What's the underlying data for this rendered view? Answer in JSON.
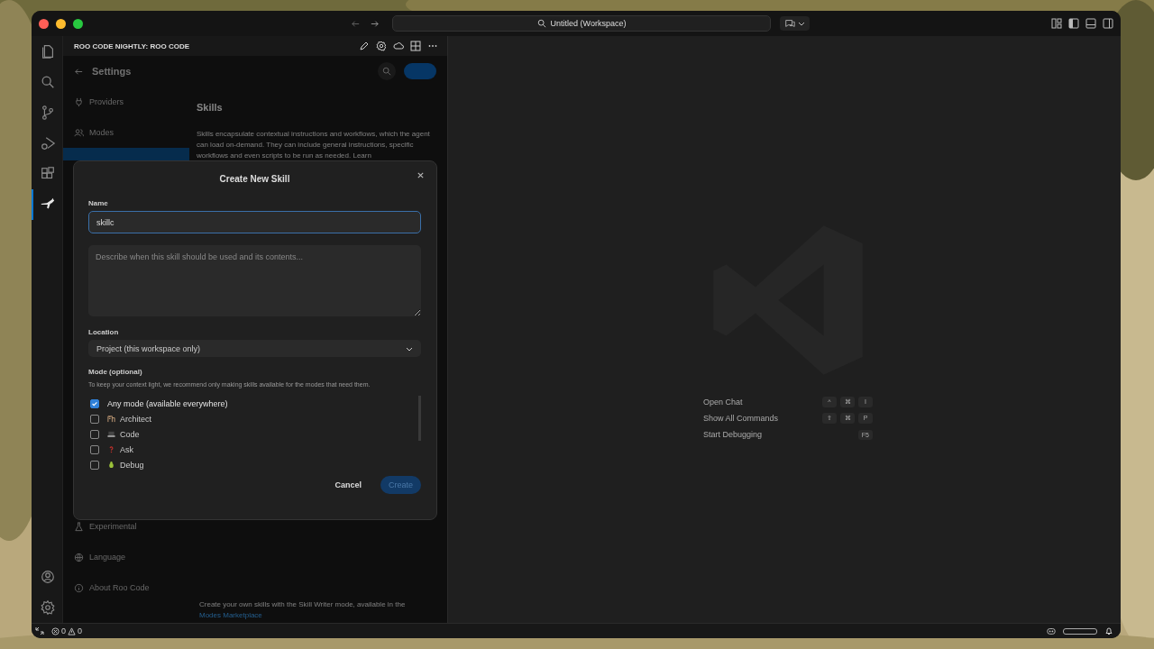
{
  "window": {
    "title": "Untitled (Workspace)"
  },
  "activity_bar": {
    "top": [
      {
        "kind": "files",
        "selected": false
      },
      {
        "kind": "search",
        "selected": false
      },
      {
        "kind": "source-control",
        "selected": false
      },
      {
        "kind": "run-debug",
        "selected": false
      },
      {
        "kind": "extensions",
        "selected": false
      },
      {
        "kind": "roo",
        "selected": true
      }
    ],
    "bottom": [
      {
        "kind": "account",
        "selected": false
      },
      {
        "kind": "settings",
        "selected": false
      }
    ]
  },
  "sidebar": {
    "title": "ROO CODE NIGHTLY: ROO CODE",
    "settings": {
      "title": "Settings",
      "nav_top": [
        {
          "kind": "plug",
          "label": "Providers"
        },
        {
          "kind": "people",
          "label": "Modes"
        }
      ],
      "nav_bottom": [
        {
          "kind": "flask",
          "label": "Experimental"
        },
        {
          "kind": "globe",
          "label": "Language"
        },
        {
          "kind": "info",
          "label": "About Roo Code"
        }
      ],
      "section_title": "Skills",
      "description": "Skills encapsulate contextual instructions and workflows, which the agent can load on-demand. They can include general instructions, specific workflows and even scripts to be run as needed. Learn",
      "footer_text": "Create your own skills with the Skill Writer mode, available in the",
      "footer_link": "Modes Marketplace"
    }
  },
  "dialog": {
    "title": "Create New Skill",
    "name_label": "Name",
    "name_value": "skillc",
    "description_placeholder": "Describe when this skill should be used and its contents...",
    "location_label": "Location",
    "location_value": "Project (this workspace only)",
    "mode_label": "Mode (optional)",
    "mode_hint": "To keep your context light, we recommend only making skills available for the modes that need them.",
    "modes": [
      {
        "kind": "any",
        "label": "Any mode (available everywhere)",
        "checked": true
      },
      {
        "kind": "architect",
        "label": "Architect",
        "checked": false
      },
      {
        "kind": "code",
        "label": "Code",
        "checked": false
      },
      {
        "kind": "ask",
        "label": "Ask",
        "checked": false
      },
      {
        "kind": "debug",
        "label": "Debug",
        "checked": false
      }
    ],
    "buttons": [
      {
        "kind": "cancel",
        "label": "Cancel",
        "disabled": false
      },
      {
        "kind": "create",
        "label": "Create",
        "disabled": true
      }
    ]
  },
  "editor": {
    "shortcuts": [
      {
        "label": "Open Chat",
        "keys": [
          "^",
          "⌘",
          "I"
        ]
      },
      {
        "label": "Show All Commands",
        "keys": [
          "⇧",
          "⌘",
          "P"
        ]
      },
      {
        "label": "Start Debugging",
        "keys": [
          "F5"
        ]
      }
    ]
  },
  "status_bar": {
    "errors": "0",
    "warnings": "0"
  }
}
